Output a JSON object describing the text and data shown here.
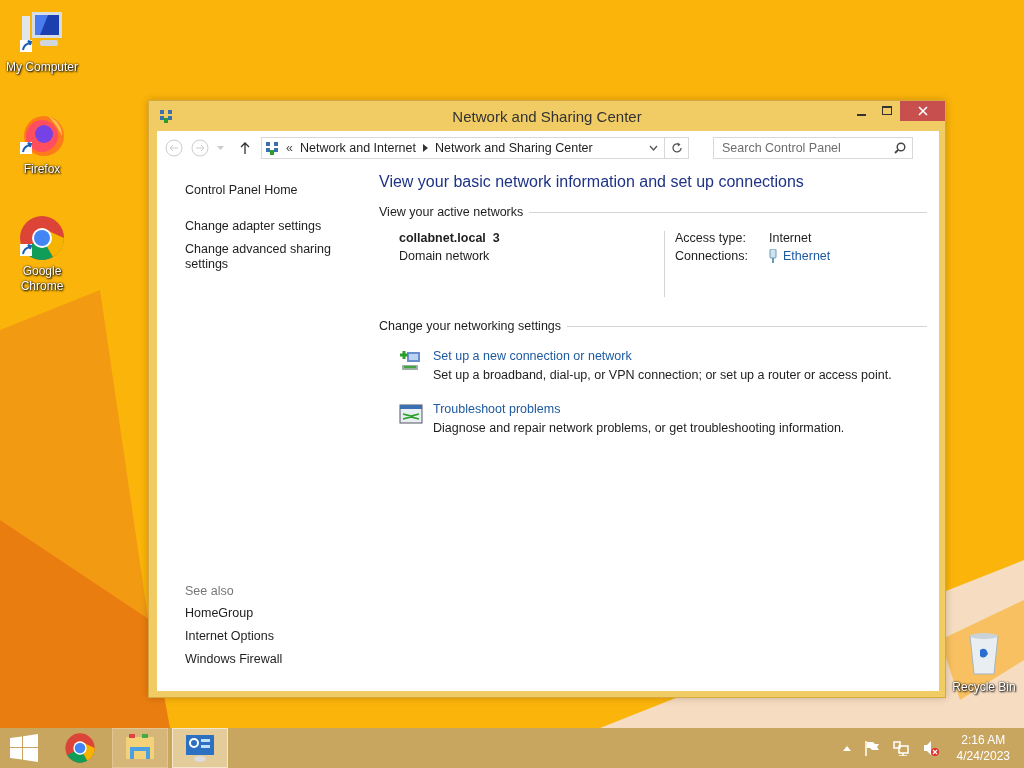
{
  "desktop_icons": [
    {
      "kind": "computer",
      "label": "My Computer"
    },
    {
      "kind": "firefox",
      "label": "Firefox"
    },
    {
      "kind": "chrome",
      "label": "Google Chrome"
    },
    {
      "kind": "recycle-bin",
      "label": "Recycle Bin"
    }
  ],
  "window": {
    "title": "Network and Sharing Center",
    "address": {
      "overflow": "«",
      "crumbs": [
        "Network and Internet",
        "Network and Sharing Center"
      ]
    },
    "search": {
      "placeholder": "Search Control Panel"
    },
    "sidebar": {
      "links": [
        "Control Panel Home",
        "Change adapter settings",
        "Change advanced sharing settings"
      ],
      "see_also_title": "See also",
      "see_also": [
        "HomeGroup",
        "Internet Options",
        "Windows Firewall"
      ]
    },
    "heading": "View your basic network information and set up connections",
    "active_networks_title": "View your active networks",
    "network": {
      "name": "collabnet.local  3",
      "type": "Domain network",
      "details": [
        {
          "label": "Access type:",
          "value": "Internet",
          "kind": "text"
        },
        {
          "label": "Connections:",
          "value": "Ethernet",
          "kind": "link"
        }
      ]
    },
    "settings_title": "Change your networking settings",
    "tasks": [
      {
        "kind": "new-connection",
        "title": "Set up a new connection or network",
        "description": "Set up a broadband, dial-up, or VPN connection; or set up a router or access point."
      },
      {
        "kind": "troubleshoot",
        "title": "Troubleshoot problems",
        "description": "Diagnose and repair network problems, or get troubleshooting information."
      }
    ]
  },
  "taskbar": {
    "items": [
      {
        "kind": "chrome",
        "open": false,
        "selected": false
      },
      {
        "kind": "explorer",
        "open": true,
        "selected": false
      },
      {
        "kind": "control-panel",
        "open": true,
        "selected": true
      }
    ],
    "time": "2:16 AM",
    "date": "4/24/2023"
  }
}
